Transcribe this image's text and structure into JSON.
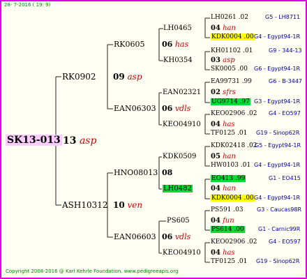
{
  "date": "28- 7-2016 ( 19: 9)",
  "footer": "Copyright 2008-2016 @ Karl Kehrle Foundation.   www.pedigreeapis.org",
  "colors": {
    "border": "#e000e0",
    "subject": "#ffccff",
    "yellow": "#ffff00",
    "green": "#00dd33",
    "note": "#cc0000",
    "location": "#000099"
  },
  "subject": {
    "ring": "SK13-013",
    "num": "13",
    "note": "asp"
  },
  "sire": {
    "ring": "RK0902",
    "num": "09",
    "note": "asp"
  },
  "dam": {
    "ring": "ASH10312",
    "num": "10",
    "note": "ven"
  },
  "gen3": [
    {
      "ring": "RK0605",
      "num": "06",
      "note": "has"
    },
    {
      "ring": "EAN06303",
      "num": "06",
      "note": "vdls"
    },
    {
      "ring": "HNO08013",
      "num": "08",
      "note": ""
    },
    {
      "ring": "EAN06603",
      "num": "06",
      "note": "vdls"
    }
  ],
  "gen4": [
    {
      "ring": "LH0465",
      "num": "04",
      "note": "han"
    },
    {
      "ring": "KH0354",
      "num": "03",
      "note": "asp"
    },
    {
      "ring": "EAN02321",
      "num": "02",
      "note": "sfrs"
    },
    {
      "ring": "KEO04910",
      "num": "04",
      "note": "has"
    },
    {
      "ring": "KDK0509",
      "num": "05",
      "note": "han"
    },
    {
      "ring": "LH0482",
      "num": "04",
      "note": "han"
    },
    {
      "ring": "PS605",
      "num": "04",
      "note": "fun"
    },
    {
      "ring": "KEO04910",
      "num": "04",
      "note": "has"
    }
  ],
  "gen5": [
    {
      "ring": "LH0261",
      "year": ".02",
      "loc": "G5 - LH8711"
    },
    {
      "ring": "KDK0004",
      "year": ".00",
      "loc": "G4 - Egypt94-1R"
    },
    {
      "ring": "KH01102",
      "year": ".01",
      "loc": "G9 - 344-13"
    },
    {
      "ring": "SK0005",
      "year": ".00",
      "loc": "G6 - Egypt94-1R"
    },
    {
      "ring": "EA99731",
      "year": ".99",
      "loc": "G6 - B-3447"
    },
    {
      "ring": "UG9714",
      "year": ".97",
      "loc": "G3 - Egypt94-1R"
    },
    {
      "ring": "KEO02906",
      "year": ".02",
      "loc": "G4 - EO597"
    },
    {
      "ring": "TF0125",
      "year": ".01",
      "loc": "G19 - Sinop62R"
    },
    {
      "ring": "KDK02418",
      "year": ".02",
      "loc": "G5 - Egypt94-1R"
    },
    {
      "ring": "HW0103",
      "year": ".01",
      "loc": "G4 - Egypt94-1R"
    },
    {
      "ring": "EO413",
      "year": ".99",
      "loc": "G1 - EO415"
    },
    {
      "ring": "KDK0004",
      "year": ".00",
      "loc": "G4 - Egypt94-1R"
    },
    {
      "ring": "PS591",
      "year": ".03",
      "loc": "G3 - Caucas98R"
    },
    {
      "ring": "PS614",
      "year": ".00",
      "loc": "G1 - Carnic99R"
    },
    {
      "ring": "KEO02906",
      "year": ".02",
      "loc": "G4 - EO597"
    },
    {
      "ring": "TF0125",
      "year": ".01",
      "loc": "G19 - Sinop62R"
    }
  ]
}
